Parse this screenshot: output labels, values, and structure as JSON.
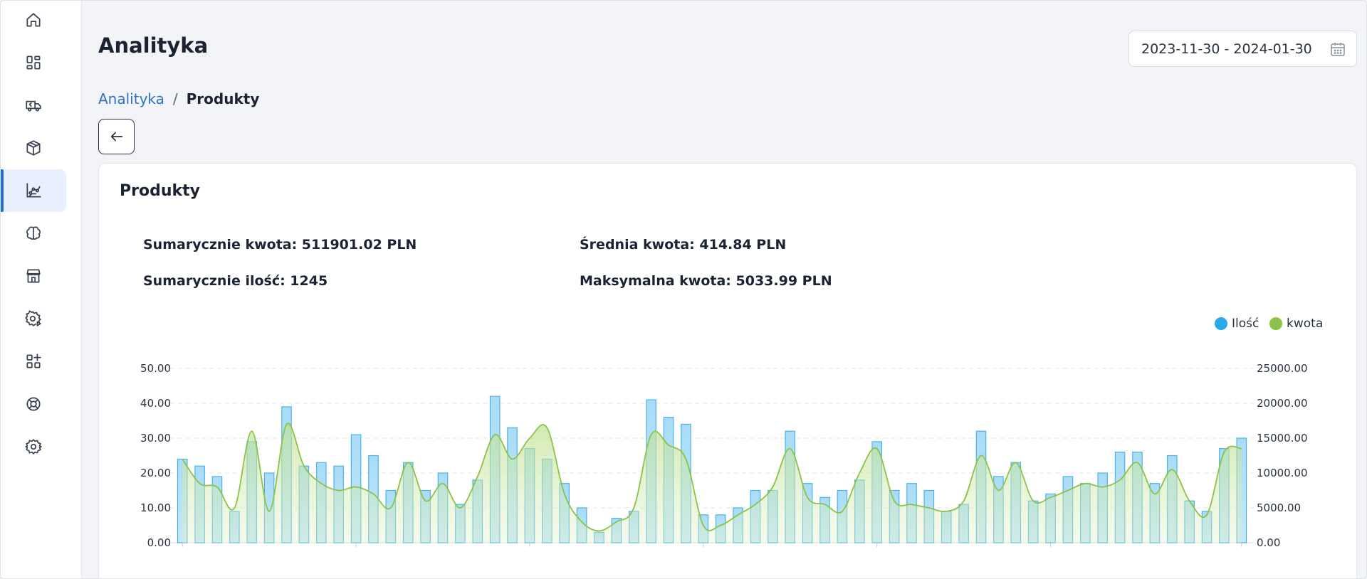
{
  "header": {
    "title": "Analityka",
    "date_range": "2023-11-30 - 2024-01-30"
  },
  "breadcrumb": {
    "link": "Analityka",
    "separator": "/",
    "current": "Produkty"
  },
  "sidebar": {
    "items": [
      {
        "icon": "home-icon",
        "active": false
      },
      {
        "icon": "dashboard-icon",
        "active": false
      },
      {
        "icon": "delivery-truck-icon",
        "active": false
      },
      {
        "icon": "box-icon",
        "active": false
      },
      {
        "icon": "analytics-chart-icon",
        "active": true
      },
      {
        "icon": "brain-icon",
        "active": false
      },
      {
        "icon": "store-icon",
        "active": false
      },
      {
        "icon": "settings-play-icon",
        "active": false
      },
      {
        "icon": "add-apps-icon",
        "active": false
      },
      {
        "icon": "support-lifebuoy-icon",
        "active": false
      },
      {
        "icon": "gear-icon",
        "active": false
      }
    ],
    "accent_color": "#1e6fd9"
  },
  "card": {
    "title": "Produkty",
    "stats": {
      "sum_amount": "Sumarycznie kwota: 511901.02 PLN",
      "avg_amount": "Średnia kwota: 414.84 PLN",
      "sum_qty": "Sumarycznie ilość: 1245",
      "max_amount": "Maksymalna kwota: 5033.99 PLN"
    }
  },
  "chart_data": {
    "type": "bar",
    "legend": [
      {
        "name": "Ilość",
        "color": "#2aa8ea"
      },
      {
        "name": "kwota",
        "color": "#8bc34a"
      }
    ],
    "legend_position": "top-right",
    "grid": true,
    "y_left": {
      "ticks": [
        "0.00",
        "10.00",
        "20.00",
        "30.00",
        "40.00",
        "50.00"
      ],
      "ylim": [
        0,
        50
      ]
    },
    "y_right": {
      "ticks": [
        "0.00",
        "5000.00",
        "10000.00",
        "15000.00",
        "20000.00",
        "25000.00"
      ],
      "ylim": [
        0,
        25000
      ]
    },
    "series": [
      {
        "name": "Ilość",
        "type": "bar",
        "values": [
          24,
          22,
          19,
          9,
          29,
          20,
          39,
          22,
          23,
          22,
          31,
          25,
          15,
          23,
          15,
          20,
          11,
          18,
          42,
          33,
          27,
          24,
          17,
          10,
          3,
          7,
          9,
          41,
          36,
          34,
          8,
          8,
          10,
          15,
          15,
          32,
          17,
          13,
          15,
          18,
          29,
          15,
          17,
          15,
          9,
          11,
          32,
          19,
          23,
          12,
          14,
          19,
          17,
          20,
          26,
          26,
          17,
          25,
          12,
          9,
          27,
          30
        ]
      },
      {
        "name": "kwota",
        "type": "area",
        "values": [
          12000,
          8500,
          8000,
          5000,
          16000,
          4500,
          17000,
          11000,
          8500,
          7500,
          8000,
          7000,
          5000,
          11500,
          6000,
          8500,
          5000,
          9500,
          15500,
          12000,
          15000,
          16500,
          7000,
          3000,
          1700,
          3000,
          5000,
          15500,
          14000,
          12000,
          2500,
          2500,
          4000,
          5500,
          8000,
          13500,
          6500,
          5500,
          4500,
          10000,
          13500,
          6000,
          5500,
          5000,
          4500,
          6000,
          12500,
          7500,
          11500,
          6000,
          6500,
          7500,
          8500,
          8000,
          9000,
          11500,
          7000,
          10500,
          6000,
          4000,
          13000,
          13500
        ]
      }
    ]
  }
}
